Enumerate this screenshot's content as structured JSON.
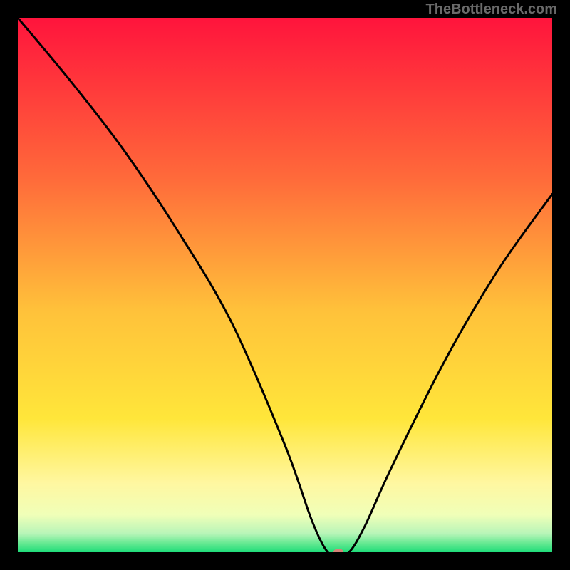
{
  "watermark": "TheBottleneck.com",
  "chart_data": {
    "type": "line",
    "title": "",
    "xlabel": "",
    "ylabel": "",
    "xlim": [
      0,
      100
    ],
    "ylim": [
      0,
      100
    ],
    "x": [
      0,
      10,
      20,
      30,
      40,
      50,
      55,
      58,
      60,
      62,
      65,
      70,
      80,
      90,
      100
    ],
    "values": [
      100,
      88,
      75,
      60,
      43,
      20,
      6,
      0,
      0,
      0,
      5,
      16,
      36,
      53,
      67
    ],
    "marker": {
      "x": 60,
      "y": 0,
      "color": "#d68378",
      "rx": 7,
      "ry": 5
    },
    "gradient_stops": [
      {
        "offset": 0.0,
        "color": "#ff143c"
      },
      {
        "offset": 0.3,
        "color": "#ff6a3a"
      },
      {
        "offset": 0.55,
        "color": "#ffc23a"
      },
      {
        "offset": 0.75,
        "color": "#ffe63a"
      },
      {
        "offset": 0.87,
        "color": "#fff7a0"
      },
      {
        "offset": 0.93,
        "color": "#f0ffb8"
      },
      {
        "offset": 0.965,
        "color": "#b8f5b8"
      },
      {
        "offset": 0.985,
        "color": "#5fe88f"
      },
      {
        "offset": 1.0,
        "color": "#1fdc7a"
      }
    ],
    "line_color": "#000000",
    "line_width": 3
  }
}
